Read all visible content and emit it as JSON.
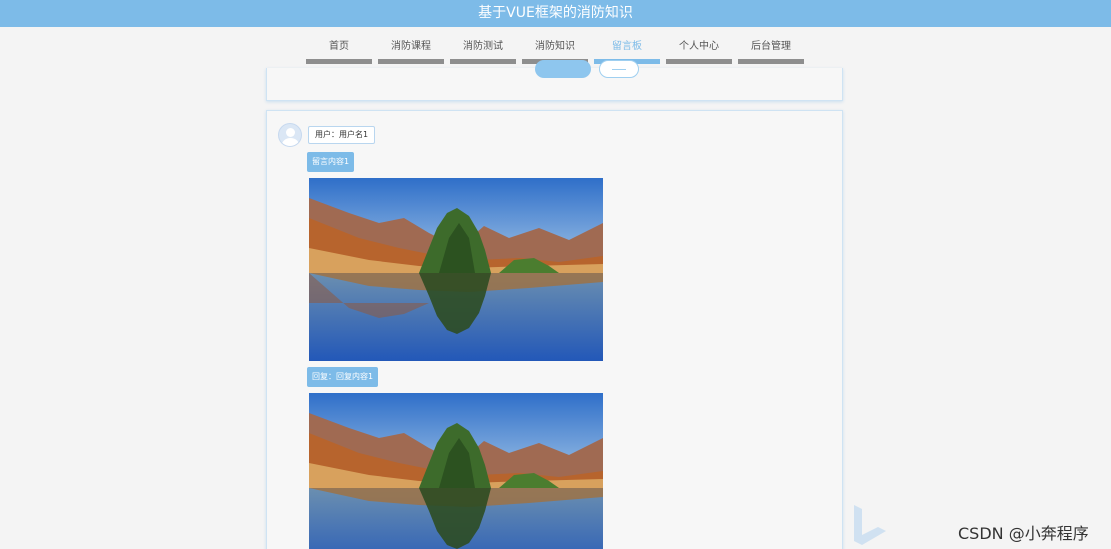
{
  "header": {
    "title": "基于VUE框架的消防知识"
  },
  "nav": {
    "items": [
      {
        "label": "首页",
        "active": false
      },
      {
        "label": "消防课程",
        "active": false
      },
      {
        "label": "消防测试",
        "active": false
      },
      {
        "label": "消防知识",
        "active": false
      },
      {
        "label": "留言板",
        "active": true
      },
      {
        "label": "个人中心",
        "active": false
      },
      {
        "label": "后台管理",
        "active": false
      }
    ]
  },
  "message": {
    "user_label": "用户：用户名1",
    "content_label": "留言内容1",
    "reply_label": "回复：回复内容1"
  },
  "watermark": "CSDN @小奔程序",
  "colors": {
    "accent": "#7dbbe8",
    "tab_inactive": "#8e8e8e"
  }
}
